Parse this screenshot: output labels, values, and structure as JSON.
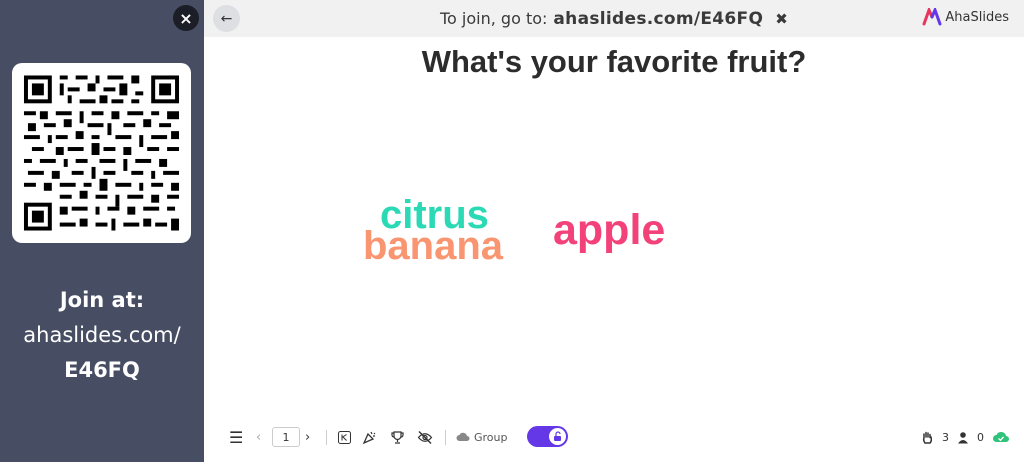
{
  "sidebar": {
    "close_label": "×",
    "join_title": "Join at:",
    "join_url": "ahaslides.com/",
    "join_code": "E46FQ"
  },
  "topbar": {
    "back_label": "←",
    "join_prefix": "To join, go to:",
    "join_link": "ahaslides.com/E46FQ",
    "close_label": "✖",
    "brand": "AhaSlides"
  },
  "slide": {
    "question": "What's your favorite fruit?",
    "words": [
      {
        "text": "citrus",
        "color": "#2bd9b5"
      },
      {
        "text": "banana",
        "color": "#f99671"
      },
      {
        "text": "apple",
        "color": "#f3417a"
      }
    ]
  },
  "bottombar": {
    "menu_icon": "☰",
    "prev_icon": "‹",
    "page_number": "1",
    "next_icon": "›",
    "group_label": "Group",
    "hands_count": "3",
    "audience_count": "0",
    "accent_color": "#6438e6"
  }
}
